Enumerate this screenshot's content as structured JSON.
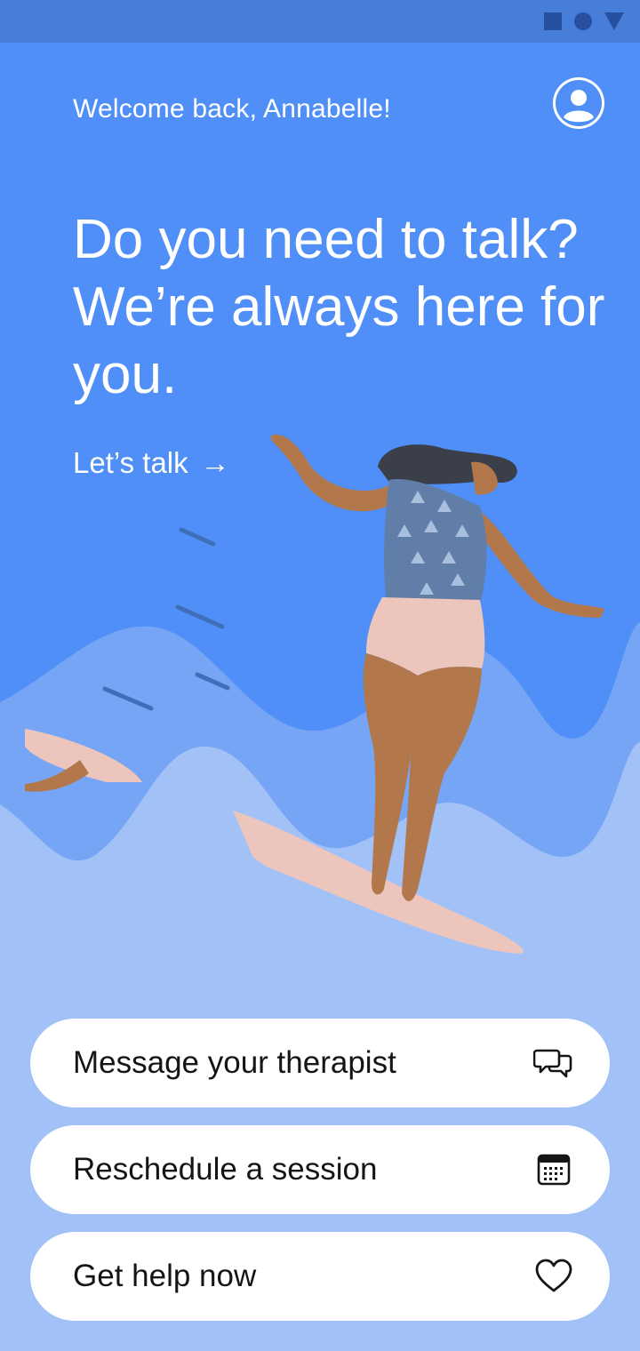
{
  "status_bar": {
    "icons": [
      "square-icon",
      "circle-icon",
      "triangle-icon"
    ]
  },
  "header": {
    "welcome": "Welcome back, Annabelle!",
    "avatar_icon": "user-avatar-icon"
  },
  "hero": {
    "headline": "Do you need to talk? We’re always here for you.",
    "cta_label": "Let’s talk",
    "cta_arrow": "→"
  },
  "actions": [
    {
      "label": "Message your therapist",
      "icon": "chat-bubbles-icon"
    },
    {
      "label": "Reschedule a session",
      "icon": "calendar-icon"
    },
    {
      "label": "Get help now",
      "icon": "heart-icon"
    }
  ],
  "colors": {
    "background": "#4f8ff7",
    "status_bar": "#477ed9",
    "wave_mid": "#77a5f5",
    "wave_light": "#a2c1f7",
    "button": "#ffffff",
    "text_dark": "#151515"
  }
}
